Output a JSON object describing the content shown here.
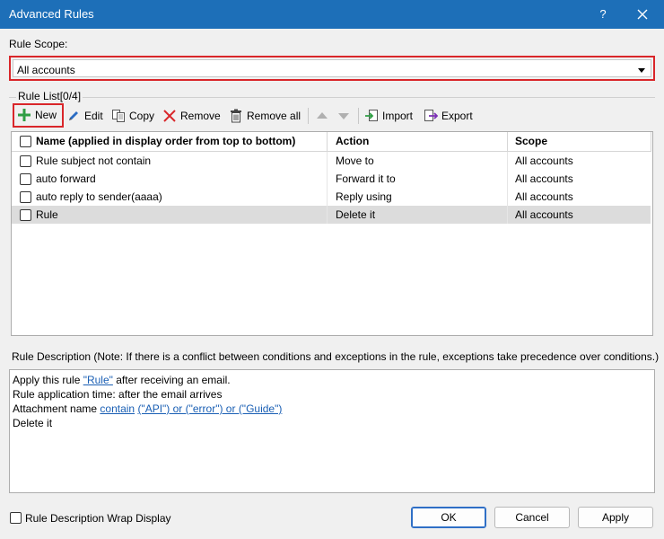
{
  "window": {
    "title": "Advanced Rules",
    "help_label": "?",
    "close_icon": "close-icon"
  },
  "scope": {
    "label": "Rule Scope:",
    "selected": "All accounts"
  },
  "rule_list": {
    "label": "Rule List[0/4]",
    "toolbar": {
      "new": "New",
      "edit": "Edit",
      "copy": "Copy",
      "remove": "Remove",
      "remove_all": "Remove all",
      "import": "Import",
      "export": "Export"
    },
    "columns": [
      "Name (applied in display order from top to bottom)",
      "Action",
      "Scope"
    ],
    "rows": [
      {
        "name": "Rule subject not contain",
        "action": "Move to",
        "scope": "All accounts"
      },
      {
        "name": "auto forward",
        "action": "Forward it to",
        "scope": "All accounts"
      },
      {
        "name": "auto reply to sender(aaaa)",
        "action": "Reply using",
        "scope": "All accounts"
      },
      {
        "name": "Rule",
        "action": "Delete it",
        "scope": "All accounts"
      }
    ]
  },
  "description": {
    "label": "Rule Description (Note: If there is a conflict between conditions and exceptions in the rule, exceptions take precedence over conditions.)",
    "line1_prefix": "Apply this rule ",
    "line1_link": "\"Rule\"",
    "line1_suffix": " after receiving an email.",
    "line2": "Rule application time: after the email arrives",
    "line3_prefix": "Attachment name ",
    "line3_link1": "contain",
    "line3_space": " ",
    "line3_link2": "(\"API\") or (\"error\") or (\"Guide\")",
    "line4": "Delete it"
  },
  "footer": {
    "wrap_label": "Rule Description Wrap Display",
    "ok": "OK",
    "cancel": "Cancel",
    "apply": "Apply"
  },
  "colors": {
    "titlebar": "#1d6fb8",
    "highlight": "#d9262a",
    "link": "#1a5fb4",
    "selected_row": "#dcdcdc"
  }
}
